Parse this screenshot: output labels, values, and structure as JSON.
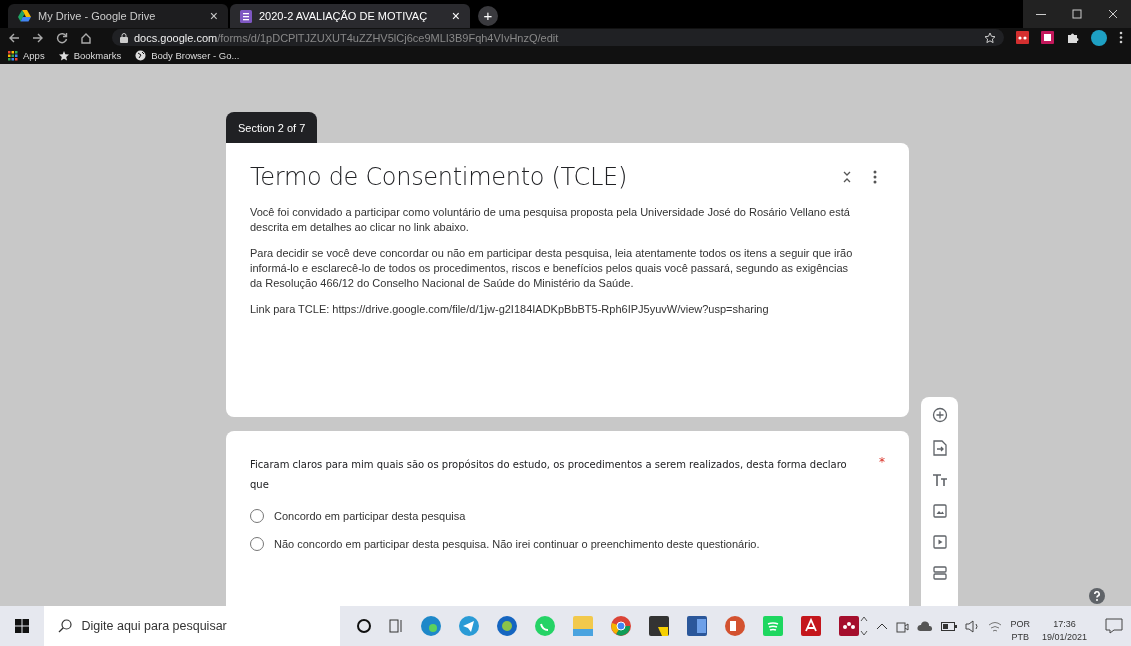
{
  "browser": {
    "tabs": [
      {
        "title": "My Drive - Google Drive",
        "close": "×",
        "selected": false
      },
      {
        "title": "2020-2 AVALIAÇÃO DE MOTIVAÇ",
        "close": "×",
        "selected": true
      }
    ],
    "new_tab": "+",
    "url": {
      "domain": "docs.google.com",
      "path": "/forms/d/1pDCPlTJZUXUT4uZZHV5lCj6ce9MLI3B9Fqh4VIvHnzQ/edit"
    },
    "bookmarks": [
      {
        "label": "Apps",
        "kind": "apps"
      },
      {
        "label": "Bookmarks",
        "kind": "star"
      },
      {
        "label": "Body Browser - Go...",
        "kind": "globe"
      }
    ]
  },
  "form": {
    "section_label": "Section 2 of 7",
    "title": "Termo de Consentimento (TCLE)",
    "description": [
      "Você foi convidado a participar como voluntário de uma pesquisa proposta pela Universidade José do Rosário Vellano está descrita em detalhes ao clicar no link abaixo.",
      "Para decidir se você deve concordar ou não em participar desta pesquisa, leia atentamente todos os itens a seguir que irão informá-lo e esclarecê-lo de todos os procedimentos, riscos e benefícios pelos quais você passará, segundo as exigências da Resolução 466/12 do Conselho Nacional de Saúde do Ministério da Saúde.",
      "Link para TCLE: https://drive.google.com/file/d/1jw-g2I184IADKpBbBT5-Rph6IPJ5yuvW/view?usp=sharing"
    ],
    "question": {
      "text": "Ficaram claros para mim quais são os propósitos do estudo, os procedimentos a serem realizados, desta forma declaro que",
      "required_mark": "*",
      "options": [
        {
          "label": "Concordo em participar desta pesquisa",
          "selected": false
        },
        {
          "label": "Não concordo em participar desta pesquisa. Não irei continuar o preenchimento deste questionário.",
          "selected": false
        }
      ]
    }
  },
  "taskbar": {
    "search_placeholder": "Digite aqui para pesquisar",
    "language": [
      "POR",
      "PTB"
    ],
    "time": "17:36",
    "date": "19/01/2021"
  }
}
